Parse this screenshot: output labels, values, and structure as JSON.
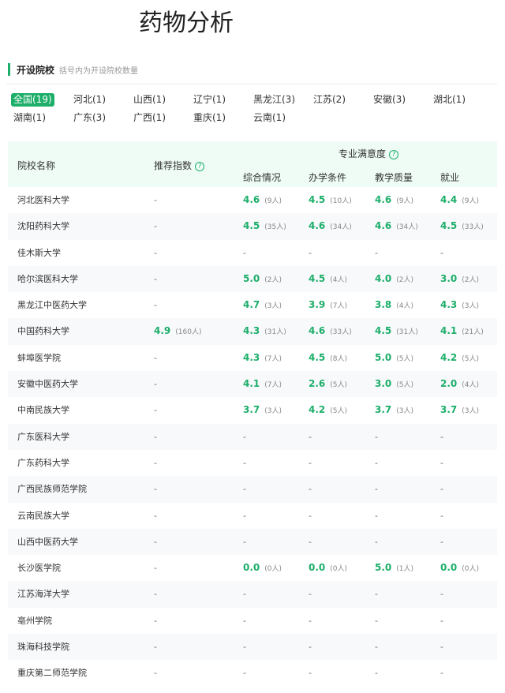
{
  "title": "药物分析",
  "section": {
    "title": "开设院校",
    "hint": "括号内为开设院校数量"
  },
  "provinces": [
    "全国(19)",
    "河北(1)",
    "山西(1)",
    "辽宁(1)",
    "黑龙江(3)",
    "江苏(2)",
    "安徽(3)",
    "湖北(1)",
    "湖南(1)",
    "广东(3)",
    "广西(1)",
    "重庆(1)",
    "云南(1)"
  ],
  "table": {
    "headers": {
      "name": "院校名称",
      "recommend": "推荐指数",
      "satisfaction": "专业满意度",
      "cols": [
        "综合情况",
        "办学条件",
        "教学质量",
        "就业"
      ]
    },
    "rows": [
      {
        "name": "河北医科大学",
        "rec": null,
        "cells": [
          [
            "4.6",
            "(9人)"
          ],
          [
            "4.5",
            "(10人)"
          ],
          [
            "4.6",
            "(9人)"
          ],
          [
            "4.4",
            "(9人)"
          ]
        ]
      },
      {
        "name": "沈阳药科大学",
        "rec": null,
        "cells": [
          [
            "4.5",
            "(35人)"
          ],
          [
            "4.6",
            "(34人)"
          ],
          [
            "4.6",
            "(34人)"
          ],
          [
            "4.5",
            "(33人)"
          ]
        ]
      },
      {
        "name": "佳木斯大学",
        "rec": null,
        "cells": [
          null,
          null,
          null,
          null
        ]
      },
      {
        "name": "哈尔滨医科大学",
        "rec": null,
        "cells": [
          [
            "5.0",
            "(2人)"
          ],
          [
            "4.5",
            "(4人)"
          ],
          [
            "4.0",
            "(2人)"
          ],
          [
            "3.0",
            "(2人)"
          ]
        ]
      },
      {
        "name": "黑龙江中医药大学",
        "rec": null,
        "cells": [
          [
            "4.7",
            "(3人)"
          ],
          [
            "3.9",
            "(7人)"
          ],
          [
            "3.8",
            "(4人)"
          ],
          [
            "4.3",
            "(3人)"
          ]
        ]
      },
      {
        "name": "中国药科大学",
        "rec": [
          "4.9",
          "(160人)"
        ],
        "cells": [
          [
            "4.3",
            "(31人)"
          ],
          [
            "4.6",
            "(33人)"
          ],
          [
            "4.5",
            "(31人)"
          ],
          [
            "4.1",
            "(21人)"
          ]
        ]
      },
      {
        "name": "蚌埠医学院",
        "rec": null,
        "cells": [
          [
            "4.3",
            "(7人)"
          ],
          [
            "4.5",
            "(8人)"
          ],
          [
            "5.0",
            "(5人)"
          ],
          [
            "4.2",
            "(5人)"
          ]
        ]
      },
      {
        "name": "安徽中医药大学",
        "rec": null,
        "cells": [
          [
            "4.1",
            "(7人)"
          ],
          [
            "2.6",
            "(5人)"
          ],
          [
            "3.0",
            "(5人)"
          ],
          [
            "2.0",
            "(4人)"
          ]
        ]
      },
      {
        "name": "中南民族大学",
        "rec": null,
        "cells": [
          [
            "3.7",
            "(3人)"
          ],
          [
            "4.2",
            "(5人)"
          ],
          [
            "3.7",
            "(3人)"
          ],
          [
            "3.7",
            "(3人)"
          ]
        ]
      },
      {
        "name": "广东医科大学",
        "rec": null,
        "cells": [
          null,
          null,
          null,
          null
        ]
      },
      {
        "name": "广东药科大学",
        "rec": null,
        "cells": [
          null,
          null,
          null,
          null
        ]
      },
      {
        "name": "广西民族师范学院",
        "rec": null,
        "cells": [
          null,
          null,
          null,
          null
        ]
      },
      {
        "name": "云南民族大学",
        "rec": null,
        "cells": [
          null,
          null,
          null,
          null
        ]
      },
      {
        "name": "山西中医药大学",
        "rec": null,
        "cells": [
          null,
          null,
          null,
          null
        ]
      },
      {
        "name": "长沙医学院",
        "rec": null,
        "cells": [
          [
            "0.0",
            "(0人)"
          ],
          [
            "0.0",
            "(0人)"
          ],
          [
            "5.0",
            "(1人)"
          ],
          [
            "0.0",
            "(0人)"
          ]
        ]
      },
      {
        "name": "江苏海洋大学",
        "rec": null,
        "cells": [
          null,
          null,
          null,
          null
        ]
      },
      {
        "name": "亳州学院",
        "rec": null,
        "cells": [
          null,
          null,
          null,
          null
        ]
      },
      {
        "name": "珠海科技学院",
        "rec": null,
        "cells": [
          null,
          null,
          null,
          null
        ]
      },
      {
        "name": "重庆第二师范学院",
        "rec": null,
        "cells": [
          null,
          null,
          null,
          null
        ]
      }
    ],
    "empty": "-"
  }
}
